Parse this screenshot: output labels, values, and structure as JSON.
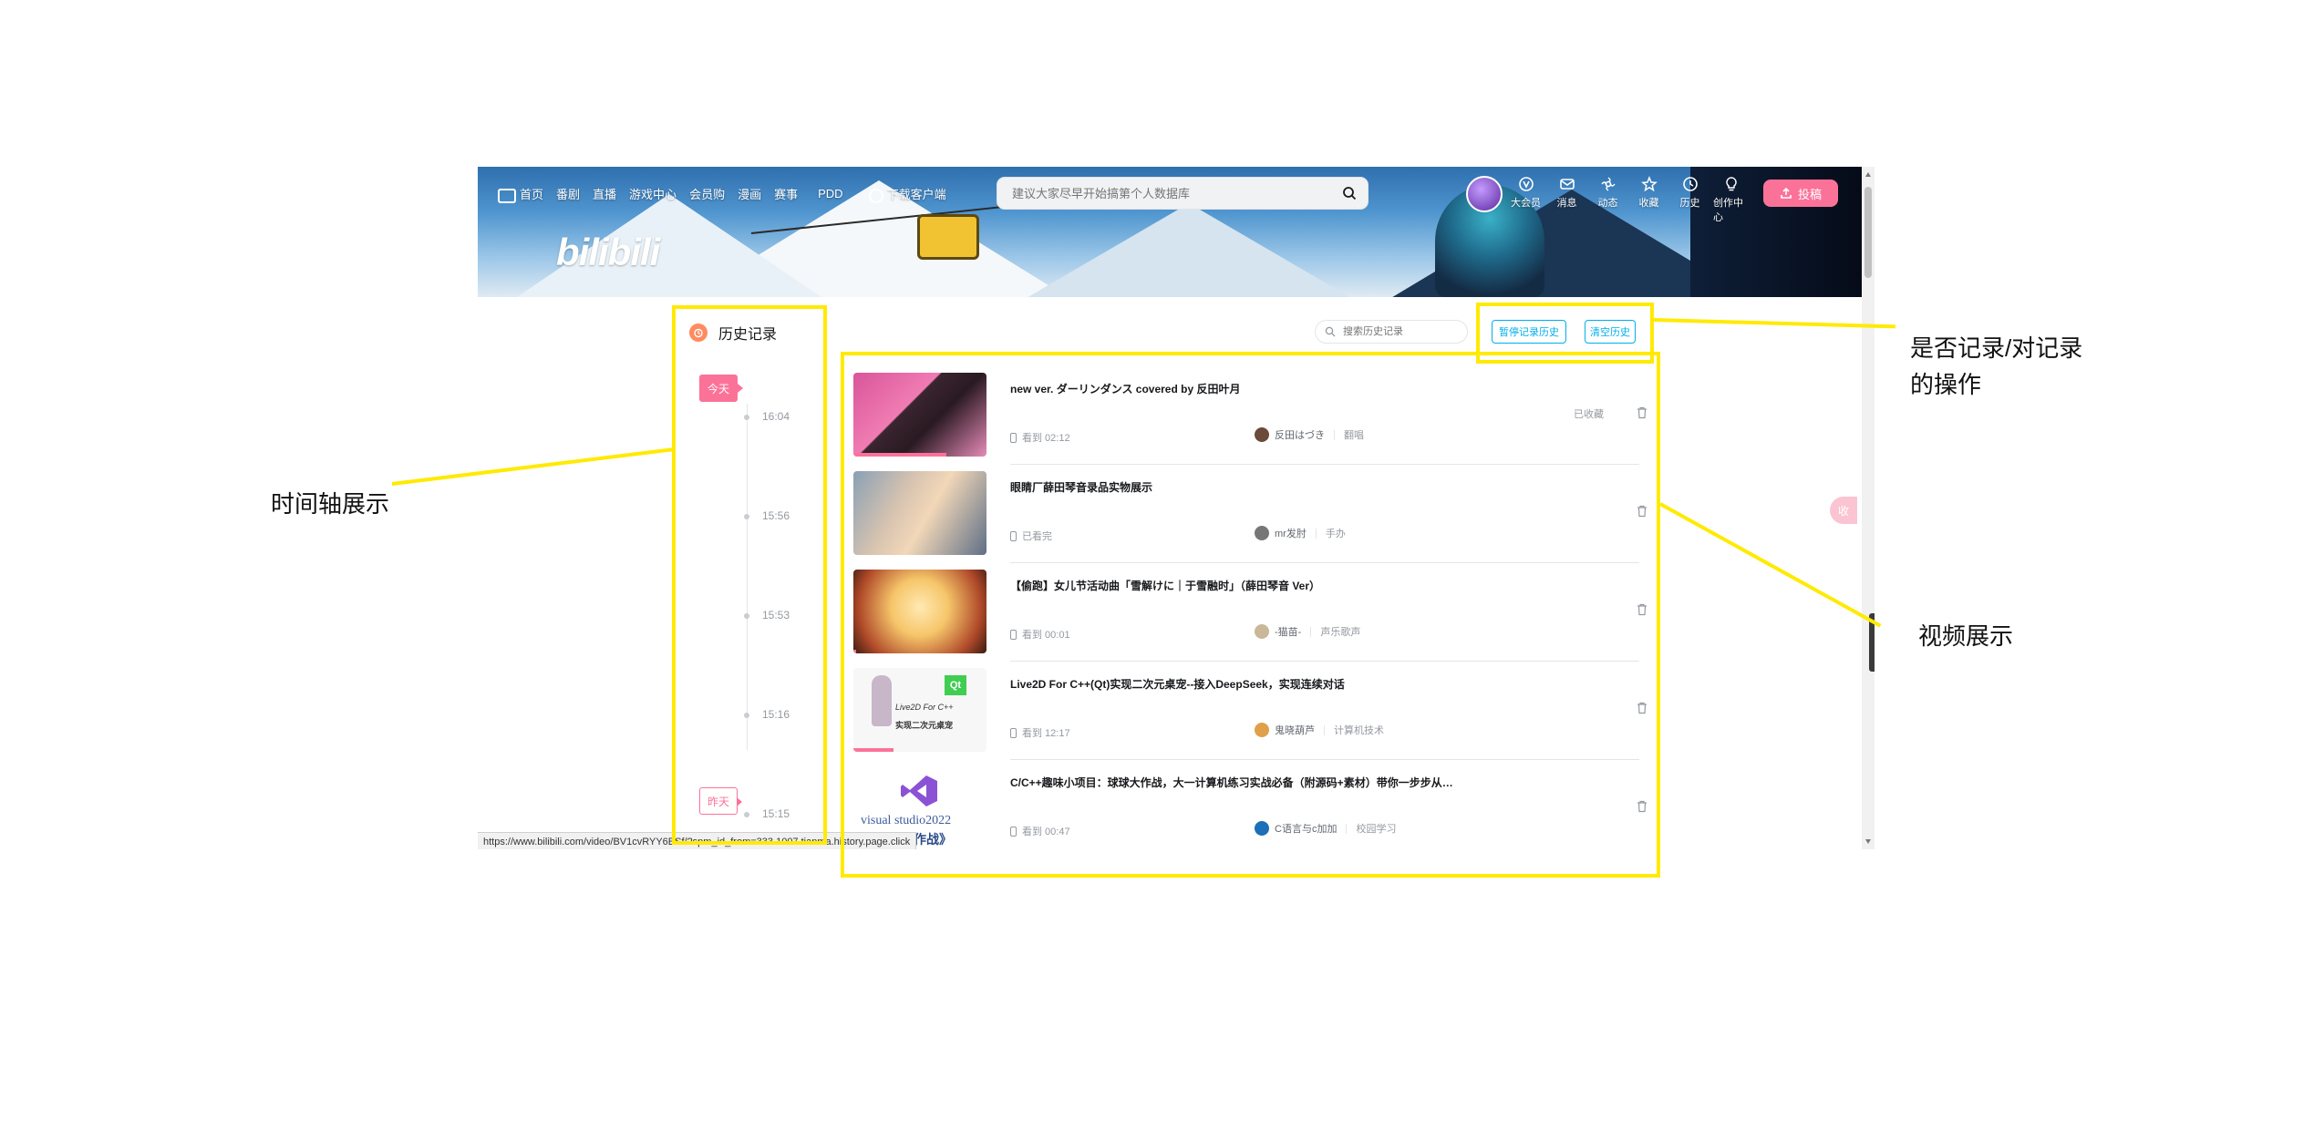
{
  "nav": {
    "items": [
      "首页",
      "番剧",
      "直播",
      "游戏中心",
      "会员购",
      "漫画",
      "赛事",
      "PDD",
      "下载客户端"
    ]
  },
  "search": {
    "placeholder": "建议大家尽早开始搞第个人数据库"
  },
  "header_right": {
    "items": [
      "大会员",
      "消息",
      "动态",
      "收藏",
      "历史",
      "创作中心"
    ],
    "upload_label": "投稿"
  },
  "logo": "bilibili",
  "history": {
    "title": "历史记录",
    "search_placeholder": "搜索历史记录",
    "pause_label": "暂停记录历史",
    "clear_label": "清空历史"
  },
  "timeline": {
    "today": "今天",
    "yesterday": "昨天",
    "times": [
      "16:04",
      "15:56",
      "15:53",
      "15:16",
      "15:15"
    ]
  },
  "videos": [
    {
      "title": "new ver. ダーリンダンス covered by 反田叶月",
      "device": "看到 02:12",
      "uploader": "反田はづき",
      "category": "翻唱",
      "fav": "已收藏",
      "progress": 0.7
    },
    {
      "title": "眼睛厂薛田琴音录品实物展示",
      "device": "已看完",
      "uploader": "mr发肘",
      "category": "手办",
      "fav": "",
      "progress": 0
    },
    {
      "title": "【偷跑】女儿节活动曲「雪解けに｜于雪融时」（薛田琴音 Ver）",
      "device": "看到 00:01",
      "uploader": "-猫苗-",
      "category": "声乐歌声",
      "fav": "",
      "progress": 0.02
    },
    {
      "title": "Live2D For C++(Qt)实现二次元桌宠--接入DeepSeek，实现连续对话",
      "device": "看到 12:17",
      "uploader": "鬼晓葫芦",
      "category": "计算机技术",
      "fav": "",
      "progress": 0.3
    },
    {
      "title": "C/C++趣味小项目：球球大作战，大一计算机练习实战必备（附源码+素材）带你一步步从…",
      "device": "看到 00:47",
      "uploader": "C语言与c加加",
      "category": "校园学习",
      "fav": "",
      "progress": 0.05
    }
  ],
  "thumb_text": {
    "v4_top": "Live2D For C++",
    "v4_mid": "实现二次元桌宠",
    "v5_brand": "visual studio2022",
    "v5_sub": "球球大作战》"
  },
  "status_url": "https://www.bilibili.com/video/BV1cvRYY6ESf/?spm_id_from=333.1007.tianma.history.page.click",
  "float_label": "收",
  "annotations": {
    "top_right": "是否记录/对记录\n的操作",
    "left": "时间轴展示",
    "right": "视频展示"
  },
  "colors": {
    "accent": "#fb7299",
    "blue": "#00aeec",
    "highlight": "#ffea00"
  }
}
